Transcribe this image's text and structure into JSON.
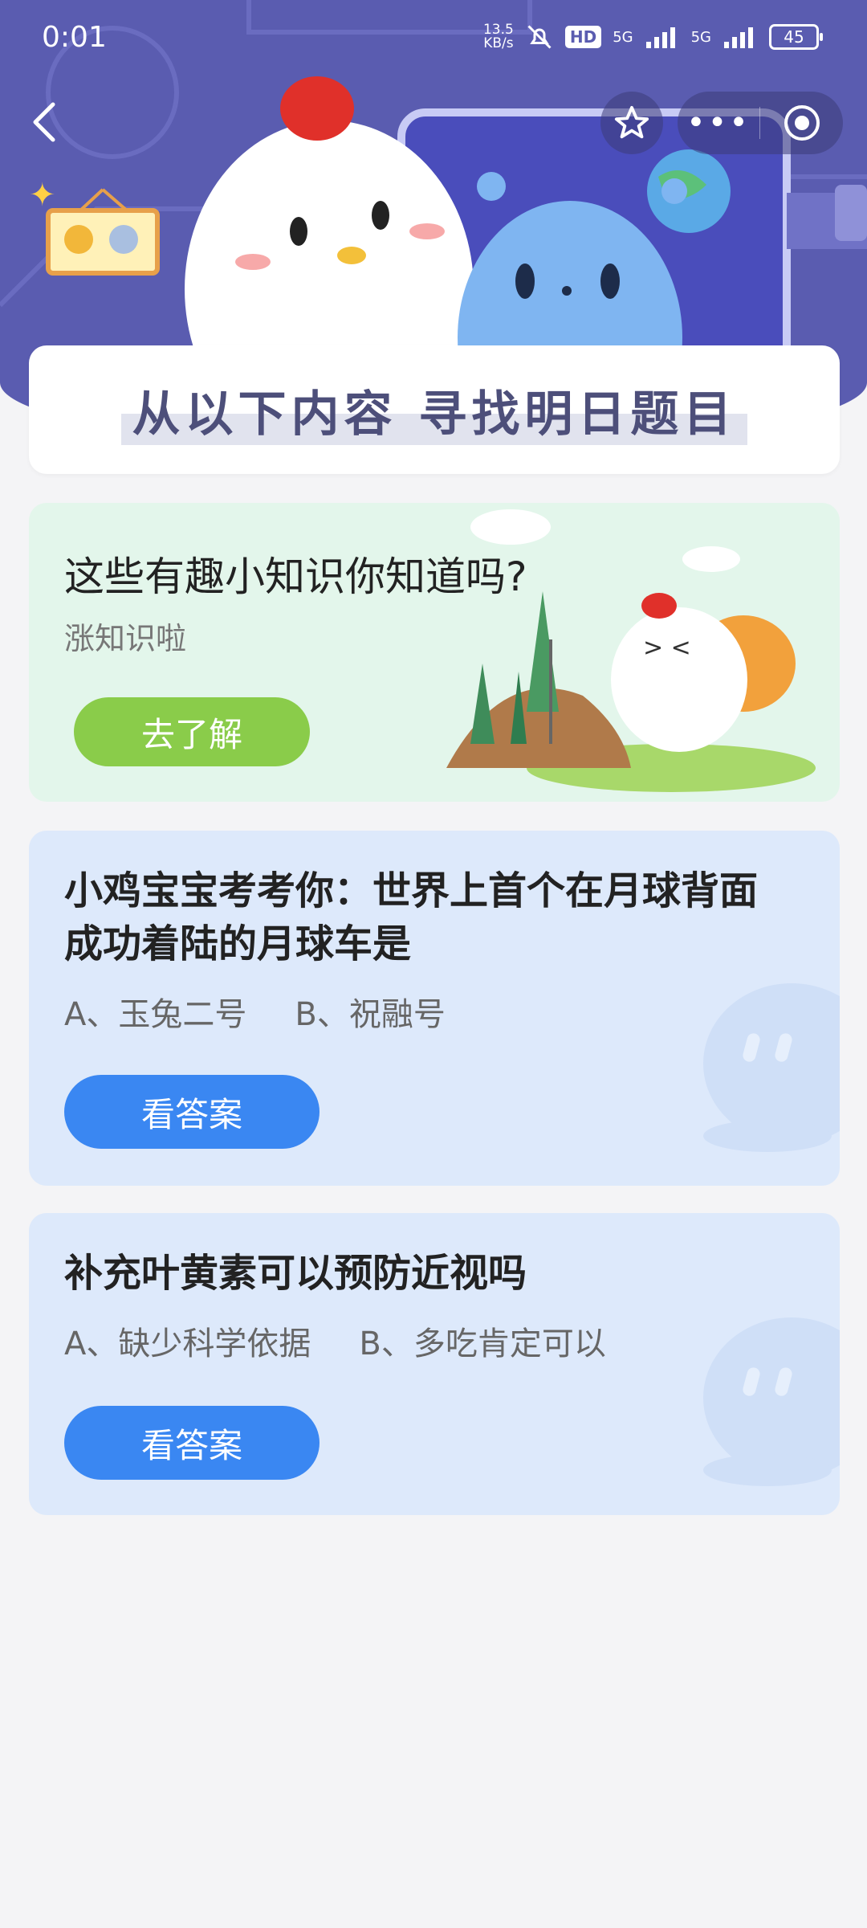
{
  "status_bar": {
    "time": "0:01",
    "net_speed_value": "13.5",
    "net_speed_unit": "KB/s",
    "hd_label": "HD",
    "signal1_label": "5G",
    "signal2_label": "5G",
    "battery": "45"
  },
  "header": {
    "banner_title": "从以下内容  寻找明日题目"
  },
  "knowledge_card": {
    "title": "这些有趣小知识你知道吗?",
    "subtitle": "涨知识啦",
    "button_label": "去了解"
  },
  "questions": [
    {
      "title": "小鸡宝宝考考你：世界上首个在月球背面成功着陆的月球车是",
      "option_a": "A、玉兔二号",
      "option_b": "B、祝融号",
      "button_label": "看答案"
    },
    {
      "title": "补充叶黄素可以预防近视吗",
      "option_a": "A、缺少科学依据",
      "option_b": "B、多吃肯定可以",
      "button_label": "看答案"
    }
  ],
  "icons": {
    "back": "chevron-left-icon",
    "favorite": "star-icon",
    "more": "more-dots-icon",
    "close": "target-circle-icon"
  },
  "colors": {
    "header_bg": "#5a5cb0",
    "primary_button": "#3a87f2",
    "green_button": "#8acc4a"
  }
}
